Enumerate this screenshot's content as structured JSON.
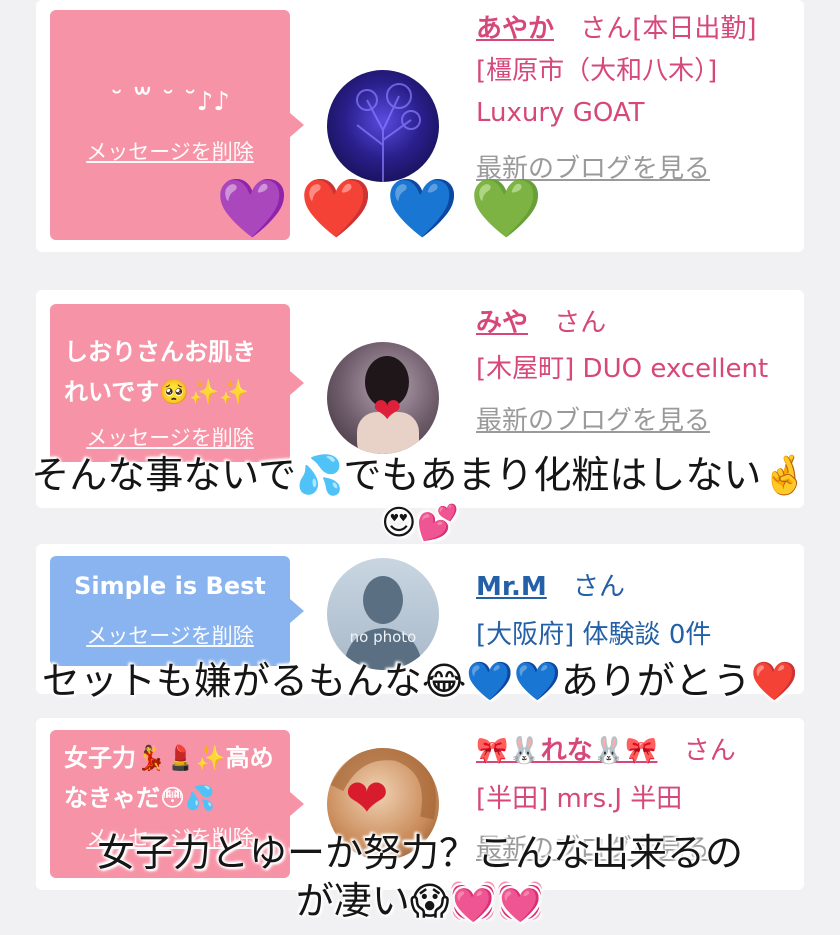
{
  "cards": [
    {
      "bubble_message": "˘ ꒳ ˘ ˘♪♪",
      "delete_label": "メッセージを削除",
      "user_name": "あやか",
      "user_suffix": "さん[本日出勤]",
      "shop_line": "[橿原市（大和八木）] Luxury GOAT",
      "blog_link": "最新のブログを見る"
    },
    {
      "bubble_message": "しおりさんお肌きれいです🥺✨✨",
      "delete_label": "メッセージを削除",
      "user_name": "みや",
      "user_suffix": "さん",
      "shop_line": "[木屋町] DUO excellent",
      "blog_link": "最新のブログを見る"
    },
    {
      "bubble_message": "Simple is Best",
      "delete_label": "メッセージを削除",
      "user_name": "Mr.M",
      "user_suffix": "さん",
      "shop_line": "[大阪府] 体験談 0件",
      "avatar_text": "no photo"
    },
    {
      "bubble_message": "女子力💃💄✨高めなきゃだ😳💦",
      "delete_label": "メッセージを削除",
      "user_name": "🎀🐰れな🐰🎀",
      "user_suffix": "さん",
      "shop_line": "[半田] mrs.J 半田",
      "blog_link": "最新のブログを見る"
    }
  ],
  "hearts": [
    "💜",
    "❤️",
    "💙",
    "💚"
  ],
  "captions": {
    "c1_line1": "そんな事ないで💦でもあまり化粧はしない🤞",
    "c1_line2": "😍💕",
    "c2": "セットも嫌がるもんな😂💙💙ありがとう❤️",
    "c3_line1": "女子力とゆーか努力？こんな出来るの",
    "c3_line2": "が凄い😱💓💓"
  },
  "colors": {
    "pink_bubble": "#f793a6",
    "blue_bubble": "#8ab4f0",
    "name_pink": "#d6477a",
    "name_blue": "#2460a8"
  }
}
